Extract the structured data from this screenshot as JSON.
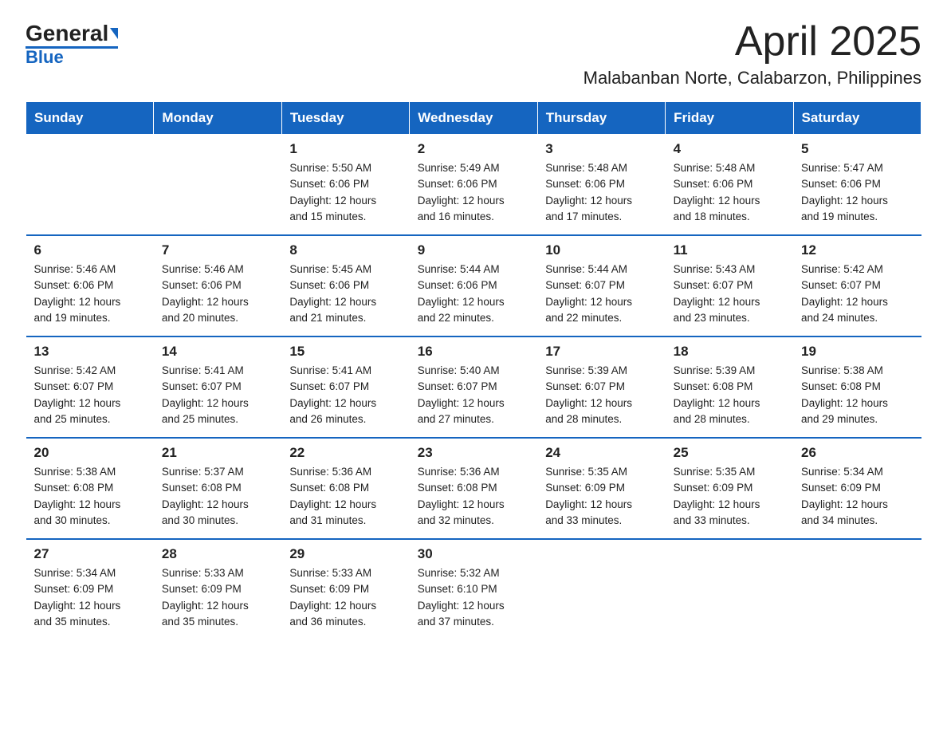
{
  "logo": {
    "text_general": "General",
    "text_blue": "Blue"
  },
  "title": "April 2025",
  "subtitle": "Malabanban Norte, Calabarzon, Philippines",
  "weekdays": [
    "Sunday",
    "Monday",
    "Tuesday",
    "Wednesday",
    "Thursday",
    "Friday",
    "Saturday"
  ],
  "weeks": [
    [
      {
        "day": "",
        "info": ""
      },
      {
        "day": "",
        "info": ""
      },
      {
        "day": "1",
        "info": "Sunrise: 5:50 AM\nSunset: 6:06 PM\nDaylight: 12 hours\nand 15 minutes."
      },
      {
        "day": "2",
        "info": "Sunrise: 5:49 AM\nSunset: 6:06 PM\nDaylight: 12 hours\nand 16 minutes."
      },
      {
        "day": "3",
        "info": "Sunrise: 5:48 AM\nSunset: 6:06 PM\nDaylight: 12 hours\nand 17 minutes."
      },
      {
        "day": "4",
        "info": "Sunrise: 5:48 AM\nSunset: 6:06 PM\nDaylight: 12 hours\nand 18 minutes."
      },
      {
        "day": "5",
        "info": "Sunrise: 5:47 AM\nSunset: 6:06 PM\nDaylight: 12 hours\nand 19 minutes."
      }
    ],
    [
      {
        "day": "6",
        "info": "Sunrise: 5:46 AM\nSunset: 6:06 PM\nDaylight: 12 hours\nand 19 minutes."
      },
      {
        "day": "7",
        "info": "Sunrise: 5:46 AM\nSunset: 6:06 PM\nDaylight: 12 hours\nand 20 minutes."
      },
      {
        "day": "8",
        "info": "Sunrise: 5:45 AM\nSunset: 6:06 PM\nDaylight: 12 hours\nand 21 minutes."
      },
      {
        "day": "9",
        "info": "Sunrise: 5:44 AM\nSunset: 6:06 PM\nDaylight: 12 hours\nand 22 minutes."
      },
      {
        "day": "10",
        "info": "Sunrise: 5:44 AM\nSunset: 6:07 PM\nDaylight: 12 hours\nand 22 minutes."
      },
      {
        "day": "11",
        "info": "Sunrise: 5:43 AM\nSunset: 6:07 PM\nDaylight: 12 hours\nand 23 minutes."
      },
      {
        "day": "12",
        "info": "Sunrise: 5:42 AM\nSunset: 6:07 PM\nDaylight: 12 hours\nand 24 minutes."
      }
    ],
    [
      {
        "day": "13",
        "info": "Sunrise: 5:42 AM\nSunset: 6:07 PM\nDaylight: 12 hours\nand 25 minutes."
      },
      {
        "day": "14",
        "info": "Sunrise: 5:41 AM\nSunset: 6:07 PM\nDaylight: 12 hours\nand 25 minutes."
      },
      {
        "day": "15",
        "info": "Sunrise: 5:41 AM\nSunset: 6:07 PM\nDaylight: 12 hours\nand 26 minutes."
      },
      {
        "day": "16",
        "info": "Sunrise: 5:40 AM\nSunset: 6:07 PM\nDaylight: 12 hours\nand 27 minutes."
      },
      {
        "day": "17",
        "info": "Sunrise: 5:39 AM\nSunset: 6:07 PM\nDaylight: 12 hours\nand 28 minutes."
      },
      {
        "day": "18",
        "info": "Sunrise: 5:39 AM\nSunset: 6:08 PM\nDaylight: 12 hours\nand 28 minutes."
      },
      {
        "day": "19",
        "info": "Sunrise: 5:38 AM\nSunset: 6:08 PM\nDaylight: 12 hours\nand 29 minutes."
      }
    ],
    [
      {
        "day": "20",
        "info": "Sunrise: 5:38 AM\nSunset: 6:08 PM\nDaylight: 12 hours\nand 30 minutes."
      },
      {
        "day": "21",
        "info": "Sunrise: 5:37 AM\nSunset: 6:08 PM\nDaylight: 12 hours\nand 30 minutes."
      },
      {
        "day": "22",
        "info": "Sunrise: 5:36 AM\nSunset: 6:08 PM\nDaylight: 12 hours\nand 31 minutes."
      },
      {
        "day": "23",
        "info": "Sunrise: 5:36 AM\nSunset: 6:08 PM\nDaylight: 12 hours\nand 32 minutes."
      },
      {
        "day": "24",
        "info": "Sunrise: 5:35 AM\nSunset: 6:09 PM\nDaylight: 12 hours\nand 33 minutes."
      },
      {
        "day": "25",
        "info": "Sunrise: 5:35 AM\nSunset: 6:09 PM\nDaylight: 12 hours\nand 33 minutes."
      },
      {
        "day": "26",
        "info": "Sunrise: 5:34 AM\nSunset: 6:09 PM\nDaylight: 12 hours\nand 34 minutes."
      }
    ],
    [
      {
        "day": "27",
        "info": "Sunrise: 5:34 AM\nSunset: 6:09 PM\nDaylight: 12 hours\nand 35 minutes."
      },
      {
        "day": "28",
        "info": "Sunrise: 5:33 AM\nSunset: 6:09 PM\nDaylight: 12 hours\nand 35 minutes."
      },
      {
        "day": "29",
        "info": "Sunrise: 5:33 AM\nSunset: 6:09 PM\nDaylight: 12 hours\nand 36 minutes."
      },
      {
        "day": "30",
        "info": "Sunrise: 5:32 AM\nSunset: 6:10 PM\nDaylight: 12 hours\nand 37 minutes."
      },
      {
        "day": "",
        "info": ""
      },
      {
        "day": "",
        "info": ""
      },
      {
        "day": "",
        "info": ""
      }
    ]
  ]
}
